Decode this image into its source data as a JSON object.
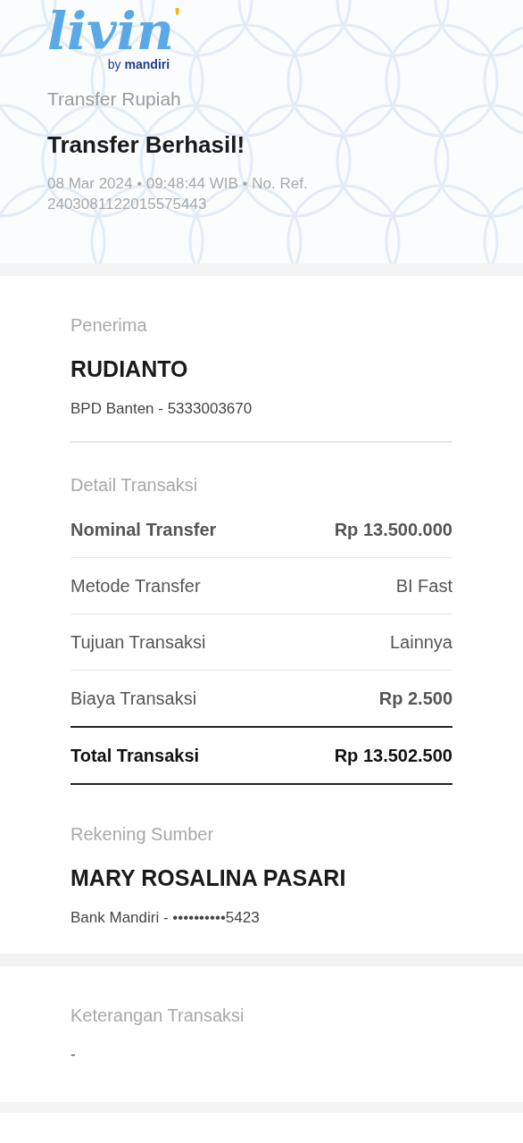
{
  "header": {
    "logo": {
      "word": "livin",
      "mark": "'",
      "byline_prefix": "by",
      "byline_brand": "mandiri"
    },
    "subtitle": "Transfer Rupiah",
    "title": "Transfer Berhasil!",
    "meta": "08 Mar 2024 • 09:48:44 WIB • No. Ref. 2403081122015575443"
  },
  "recipient": {
    "label": "Penerima",
    "name": "RUDIANTO",
    "account": "BPD Banten - 5333003670"
  },
  "details": {
    "label": "Detail Transaksi",
    "rows": [
      {
        "kind": "emphasis",
        "label": "Nominal Transfer",
        "value": "Rp 13.500.000"
      },
      {
        "kind": "plain",
        "label": "Metode Transfer",
        "value": "BI Fast"
      },
      {
        "kind": "plain",
        "label": "Tujuan Transaksi",
        "value": "Lainnya"
      },
      {
        "kind": "fee",
        "label": "Biaya Transaksi",
        "value": "Rp 2.500"
      },
      {
        "kind": "total",
        "label": "Total Transaksi",
        "value": "Rp 13.502.500"
      }
    ]
  },
  "source": {
    "label": "Rekening Sumber",
    "name": "MARY ROSALINA PASARI",
    "account": "Bank Mandiri - ••••••••••5423"
  },
  "note": {
    "label": "Keterangan Transaksi",
    "value": "-"
  }
}
